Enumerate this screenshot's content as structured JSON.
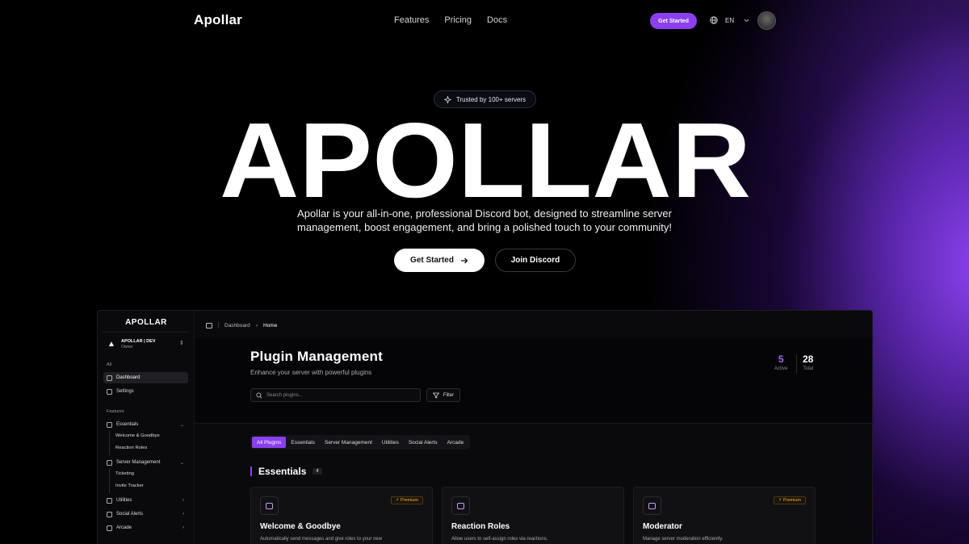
{
  "nav": {
    "logo": "Apollar",
    "links": [
      "Features",
      "Pricing",
      "Docs"
    ],
    "cta": "Get Started",
    "lang": "EN"
  },
  "hero": {
    "badge": "Trusted by 100+ servers",
    "wordmark": "APOLLAR",
    "description": "Apollar is your all-in-one, professional Discord bot, designed to streamline server management, boost engagement, and bring a polished touch to your community!",
    "primary_button": "Get Started",
    "secondary_button": "Join Discord"
  },
  "dashboard": {
    "sidebar": {
      "logo": "APOLLAR",
      "server_name": "APOLLAR | DEV",
      "server_role": "Owner",
      "group_all": "All",
      "items_all": [
        {
          "label": "Dashboard",
          "icon": "grid-icon"
        },
        {
          "label": "Settings",
          "icon": "settings-icon"
        }
      ],
      "group_features": "Features",
      "features": [
        {
          "label": "Essentials",
          "subitems": [
            "Welcome & Goodbye",
            "Reaction Roles"
          ]
        },
        {
          "label": "Server Management",
          "subitems": [
            "Ticketing",
            "Invite Tracker"
          ]
        },
        {
          "label": "Utilities"
        },
        {
          "label": "Social Alerts"
        },
        {
          "label": "Arcade"
        }
      ]
    },
    "breadcrumb": [
      "Dashboard",
      "Home"
    ],
    "header": {
      "title": "Plugin Management",
      "subtitle": "Enhance your server with powerful plugins",
      "stats": [
        {
          "value": "5",
          "label": "Active",
          "color": "#a06bff"
        },
        {
          "value": "28",
          "label": "Total",
          "color": "#ffffff"
        }
      ],
      "search_placeholder": "Search plugins...",
      "filter_label": "Filter"
    },
    "tabs": [
      "All Plugins",
      "Essentials",
      "Server Management",
      "Utilities",
      "Social Alerts",
      "Arcade"
    ],
    "active_tab": "All Plugins",
    "section": {
      "title": "Essentials",
      "count": "4"
    },
    "cards": [
      {
        "title": "Welcome & Goodbye",
        "desc": "Automatically send messages and give roles to your new",
        "premium": "Premium"
      },
      {
        "title": "Reaction Roles",
        "desc": "Allow users to self-assign roles via reactions.",
        "premium": ""
      },
      {
        "title": "Moderator",
        "desc": "Manage server moderation efficiently.",
        "premium": "Premium"
      }
    ]
  },
  "colors": {
    "accent": "#8b3ff0",
    "background": "#000000",
    "premium": "#f0b04a"
  }
}
